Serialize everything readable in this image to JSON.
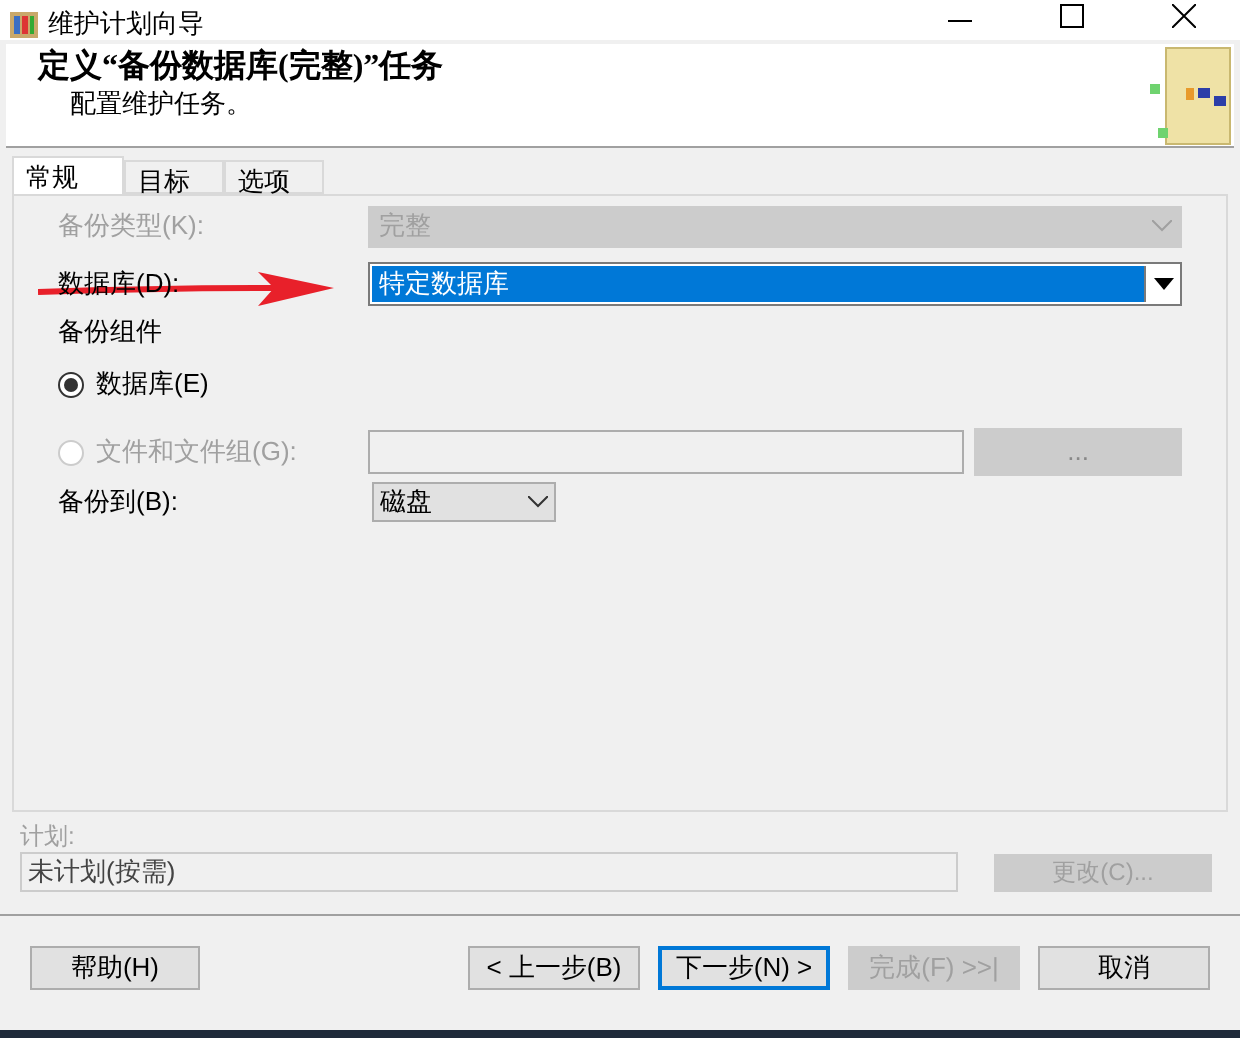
{
  "window": {
    "title": "维护计划向导"
  },
  "header": {
    "title": "定义“备份数据库(完整)”任务",
    "subtitle": "配置维护任务。"
  },
  "tabs": [
    {
      "label": "常规",
      "selected": true
    },
    {
      "label": "目标",
      "selected": false
    },
    {
      "label": "选项",
      "selected": false
    }
  ],
  "backup_type": {
    "label": "备份类型(K):",
    "value": "完整",
    "disabled": true
  },
  "database": {
    "label": "数据库(D):",
    "value": "特定数据库",
    "disabled": false
  },
  "component_label": "备份组件",
  "radios": [
    {
      "label": "数据库(E)",
      "selected": true,
      "disabled": false
    },
    {
      "label": "文件和文件组(G):",
      "selected": false,
      "disabled": true
    }
  ],
  "browse_button": {
    "label": "...",
    "disabled": true
  },
  "backup_to": {
    "label": "备份到(B):",
    "value": "磁盘"
  },
  "schedule": {
    "label": "计划:",
    "value": "未计划(按需)",
    "button": "更改(C)...",
    "disabled": true
  },
  "buttons": [
    {
      "label": "帮助(H)",
      "disabled": false,
      "focused": false
    },
    {
      "label": "< 上一步(B)",
      "disabled": false,
      "focused": false
    },
    {
      "label": "下一步(N) >",
      "disabled": false,
      "focused": true
    },
    {
      "label": "完成(F) >>|",
      "disabled": true,
      "focused": false
    },
    {
      "label": "取消",
      "disabled": false,
      "focused": false
    }
  ]
}
